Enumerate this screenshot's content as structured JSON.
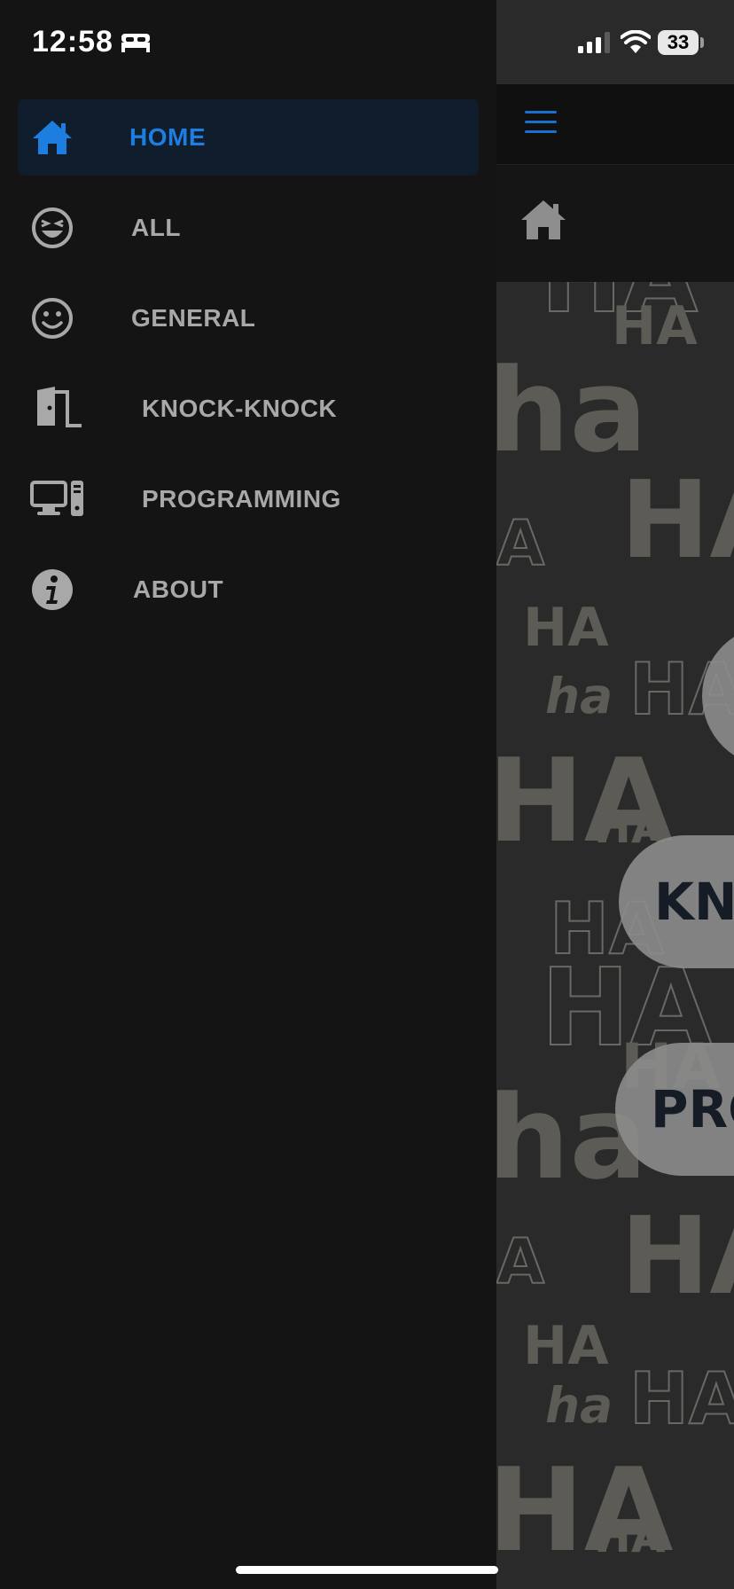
{
  "status_bar": {
    "time": "12:58",
    "battery_level": "33"
  },
  "menu": {
    "items": [
      {
        "label": "HOME",
        "icon": "home-icon",
        "active": true
      },
      {
        "label": "ALL",
        "icon": "laughing-face-icon",
        "active": false
      },
      {
        "label": "GENERAL",
        "icon": "smiley-face-icon",
        "active": false
      },
      {
        "label": "KNOCK-KNOCK",
        "icon": "door-icon",
        "active": false
      },
      {
        "label": "PROGRAMMING",
        "icon": "computer-icon",
        "active": false
      },
      {
        "label": "ABOUT",
        "icon": "info-icon",
        "active": false
      }
    ]
  },
  "background_app": {
    "pills": [
      "KN",
      "PRO"
    ]
  },
  "colors": {
    "accent": "#1e7ee0",
    "drawer_bg": "#141414",
    "active_item_bg": "#101d2d",
    "menu_text": "#a8a8a8"
  }
}
